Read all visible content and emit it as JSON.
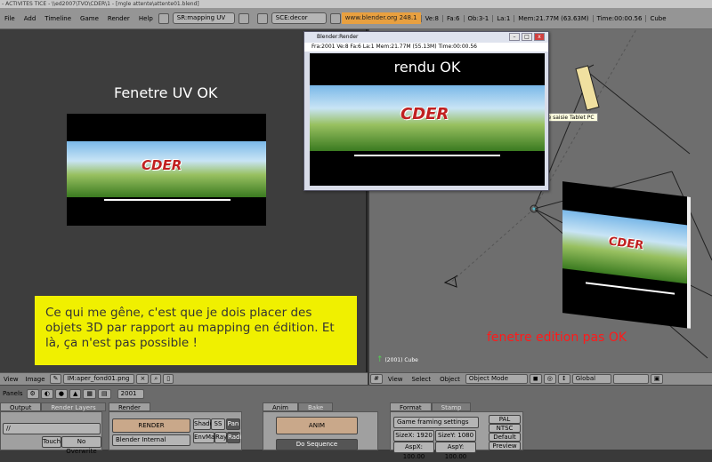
{
  "window_title": "- ACTIVITES TICE - \\\\ed2007\\TVO\\CDER\\1 - [mgle attente\\attente01.blend]",
  "menubar": {
    "items": [
      "File",
      "Add",
      "Timeline",
      "Game",
      "Render",
      "Help"
    ],
    "screen_field": "SR:mapping UV",
    "scene_field": "SCE:decor",
    "blender_url": "www.blender.org 248.1",
    "stats": [
      "Ve:8",
      "Fa:6",
      "Ob:3-1",
      "La:1",
      "Mem:21.77M (63.63M)",
      "Time:00:00.56",
      "Cube"
    ]
  },
  "uv_editor": {
    "title": "Fenetre UV OK",
    "logo": "CDER",
    "header": {
      "menus": [
        "View",
        "Image"
      ],
      "image_field": "IM:aper_fond01.png"
    }
  },
  "note": {
    "text": "Ce qui me gêne, c'est que je dois placer des objets 3D par rapport au mapping en édition. Et là, ça n'est pas possible !"
  },
  "render_window": {
    "title": "Blender:Render",
    "stats": "Fra:2001  Ve:8 Fa:6 La:1 Mem:21.77M (55.13M) Time:00:00.56",
    "render_label": "rendu OK",
    "logo": "CDER",
    "controls": [
      "–",
      "□",
      "x"
    ]
  },
  "viewport": {
    "tooltip": "Panneau de saisie Tablet PC",
    "edition_label": "fenetre edition pas OK",
    "frame_info": "(2001) Cube",
    "logo": "CDER",
    "header": {
      "menus": [
        "View",
        "Select",
        "Object"
      ],
      "mode": "Object Mode",
      "orientation": "Global"
    }
  },
  "buttons": {
    "header": {
      "panels_label": "Panels",
      "frame": "2001"
    },
    "tabs_left": [
      "Output",
      "Render Layers"
    ],
    "tabs_mid": [
      "Render"
    ],
    "tabs_anim": [
      "Anim",
      "Bake"
    ],
    "tabs_format": [
      "Format",
      "Stamp"
    ],
    "output_field": "//",
    "touch_label": "Touch",
    "no_overwrite_label": "No Overwrite",
    "render_button": "RENDER",
    "render_engine": "Blender Internal",
    "shadow_label": "Shado",
    "ss_label": "SS",
    "pano_label": "Pan",
    "envmap_label": "EnvMa",
    "ray_label": "Ray",
    "radio_label": "Radi",
    "anim_button": "ANIM",
    "do_sequence": "Do Sequence",
    "game_framing": "Game framing settings",
    "sizex": "SizeX: 1920",
    "sizey": "SizeY: 1080",
    "aspx": "AspX: 100.00",
    "aspy": "AspY: 100.00",
    "presets": [
      "PAL",
      "NTSC",
      "Default",
      "Preview"
    ]
  }
}
